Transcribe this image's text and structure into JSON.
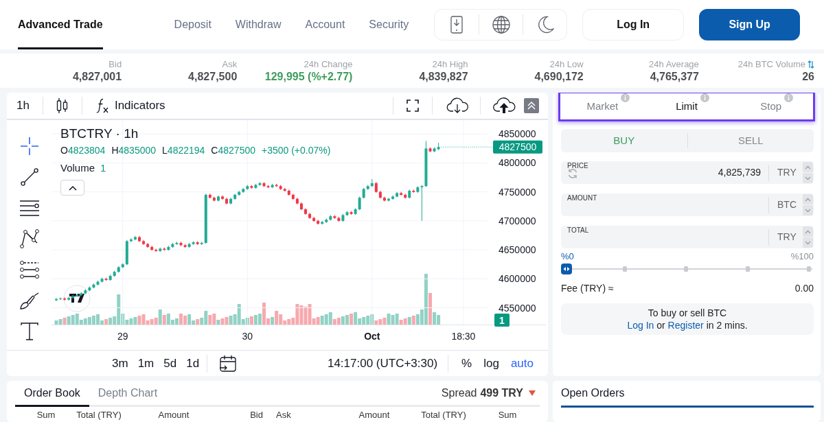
{
  "nav_tabs": [
    {
      "label": "Advanced Trade",
      "selected": true
    },
    {
      "label": "Deposit",
      "selected": false
    },
    {
      "label": "Withdraw",
      "selected": false
    },
    {
      "label": "Account",
      "selected": false
    },
    {
      "label": "Security",
      "selected": false
    }
  ],
  "auth": {
    "login": "Log In",
    "signup": "Sign Up"
  },
  "stats": [
    {
      "label": "Bid",
      "value": "4,827,001",
      "kind": "plain"
    },
    {
      "label": "Ask",
      "value": "4,827,500",
      "kind": "plain"
    },
    {
      "label": "24h Change",
      "value": "129,995 (%+2.77)",
      "kind": "change"
    },
    {
      "label": "24h High",
      "value": "4,839,827",
      "kind": "plain"
    },
    {
      "label": "24h Low",
      "value": "4,690,172",
      "kind": "plain"
    },
    {
      "label": "24h Average",
      "value": "4,765,377",
      "kind": "plain"
    },
    {
      "label": "24h BTC Volume",
      "value": "26",
      "kind": "switchable"
    }
  ],
  "chart": {
    "interval": "1h",
    "indicators": "Indicators",
    "title": "BTCTRY · 1h",
    "ohlc": [
      {
        "label": "O",
        "value": "4823804"
      },
      {
        "label": "H",
        "value": "4835000"
      },
      {
        "label": "L",
        "value": "4822194"
      },
      {
        "label": "C",
        "value": "4827500"
      }
    ],
    "change": "+3500 (+0.07%)",
    "volume_label": "Volume",
    "volume_value": "1",
    "drawing_tools": [
      {
        "kind": "crosshair",
        "selected": true
      },
      {
        "kind": "trend_line",
        "selected": false
      },
      {
        "kind": "horizontal_lines",
        "selected": false
      },
      {
        "kind": "pattern",
        "selected": false
      },
      {
        "kind": "channel",
        "selected": false
      },
      {
        "kind": "brush",
        "selected": false
      },
      {
        "kind": "text",
        "selected": false
      }
    ],
    "chart_data": {
      "type": "candlestick",
      "categories": [
        null,
        null,
        null,
        null,
        null,
        null,
        null,
        null,
        null,
        null,
        null,
        null,
        null,
        null,
        null,
        null,
        "29",
        null,
        null,
        null,
        null,
        null,
        null,
        null,
        null,
        null,
        null,
        null,
        null,
        null,
        null,
        null,
        null,
        null,
        null,
        null,
        null,
        null,
        null,
        null,
        null,
        null,
        null,
        null,
        null,
        null,
        "30",
        null,
        null,
        null,
        null,
        null,
        null,
        null,
        null,
        null,
        null,
        null,
        null,
        null,
        null,
        null,
        null,
        null,
        null,
        null,
        null,
        null,
        null,
        null,
        null,
        null,
        null,
        null,
        null,
        null,
        "Oct",
        null,
        null,
        null,
        null,
        null,
        null,
        null,
        null,
        null,
        null,
        null,
        null,
        null,
        null,
        null,
        null,
        null,
        null,
        null,
        null,
        null,
        "18:30"
      ],
      "ohlc": [
        [
          4563000,
          4567000,
          4561500,
          4565000
        ],
        [
          4565000,
          4568000,
          4563500,
          4566000
        ],
        [
          4566000,
          4568000,
          4562500,
          4564000
        ],
        [
          4564000,
          4569000,
          4562500,
          4567000
        ],
        [
          4567000,
          4572000,
          4565500,
          4570000
        ],
        [
          4570000,
          4574000,
          4568500,
          4572000
        ],
        [
          4572000,
          4577000,
          4570500,
          4575000
        ],
        [
          4575000,
          4582000,
          4573500,
          4580000
        ],
        [
          4580000,
          4587000,
          4578500,
          4585000
        ],
        [
          4585000,
          4592000,
          4583500,
          4590000
        ],
        [
          4590000,
          4597000,
          4588500,
          4595000
        ],
        [
          4595000,
          4602000,
          4593500,
          4600000
        ],
        [
          4600000,
          4602000,
          4596500,
          4598000
        ],
        [
          4598000,
          4607000,
          4596500,
          4605000
        ],
        [
          4605000,
          4614000,
          4603500,
          4612000
        ],
        [
          4612000,
          4622000,
          4610500,
          4620000
        ],
        [
          4620000,
          4627000,
          4618500,
          4625000
        ],
        [
          4625000,
          4667000,
          4623500,
          4665000
        ],
        [
          4665000,
          4670000,
          4663500,
          4668000
        ],
        [
          4668000,
          4674000,
          4666500,
          4672000
        ],
        [
          4672000,
          4674000,
          4663500,
          4665000
        ],
        [
          4665000,
          4667000,
          4658500,
          4660000
        ],
        [
          4660000,
          4662000,
          4653500,
          4655000
        ],
        [
          4655000,
          4657000,
          4648500,
          4650000
        ],
        [
          4650000,
          4652000,
          4646500,
          4648000
        ],
        [
          4648000,
          4654000,
          4646500,
          4652000
        ],
        [
          4652000,
          4654000,
          4648500,
          4650000
        ],
        [
          4650000,
          4657000,
          4648500,
          4655000
        ],
        [
          4655000,
          4662000,
          4653500,
          4660000
        ],
        [
          4660000,
          4664000,
          4658500,
          4662000
        ],
        [
          4662000,
          4664000,
          4656500,
          4658000
        ],
        [
          4658000,
          4660000,
          4653500,
          4655000
        ],
        [
          4655000,
          4662000,
          4653500,
          4660000
        ],
        [
          4660000,
          4665000,
          4658500,
          4663000
        ],
        [
          4663000,
          4665000,
          4658500,
          4660000
        ],
        [
          4660000,
          4664000,
          4658500,
          4662000
        ],
        [
          4662000,
          4747000,
          4660500,
          4745000
        ],
        [
          4745000,
          4747000,
          4738500,
          4740000
        ],
        [
          4740000,
          4742000,
          4733500,
          4735000
        ],
        [
          4735000,
          4744000,
          4733500,
          4742000
        ],
        [
          4742000,
          4744000,
          4736500,
          4738000
        ],
        [
          4738000,
          4740000,
          4728500,
          4730000
        ],
        [
          4730000,
          4740000,
          4728500,
          4738000
        ],
        [
          4738000,
          4747000,
          4736500,
          4745000
        ],
        [
          4745000,
          4752000,
          4743500,
          4750000
        ],
        [
          4750000,
          4757000,
          4748500,
          4755000
        ],
        [
          4755000,
          4762000,
          4753500,
          4760000
        ],
        [
          4760000,
          4762000,
          4755500,
          4757000
        ],
        [
          4757000,
          4764000,
          4755500,
          4762000
        ],
        [
          4762000,
          4767000,
          4760500,
          4765000
        ],
        [
          4765000,
          4767000,
          4758500,
          4760000
        ],
        [
          4760000,
          4762000,
          4756500,
          4758000
        ],
        [
          4758000,
          4764000,
          4756500,
          4762000
        ],
        [
          4762000,
          4764000,
          4758500,
          4760000
        ],
        [
          4760000,
          4762000,
          4753500,
          4755000
        ],
        [
          4755000,
          4757000,
          4750500,
          4752000
        ],
        [
          4752000,
          4754000,
          4743500,
          4745000
        ],
        [
          4745000,
          4747000,
          4736500,
          4738000
        ],
        [
          4738000,
          4740000,
          4728500,
          4730000
        ],
        [
          4730000,
          4732000,
          4718500,
          4720000
        ],
        [
          4720000,
          4722000,
          4710500,
          4712000
        ],
        [
          4712000,
          4714000,
          4703500,
          4705000
        ],
        [
          4705000,
          4707000,
          4698500,
          4700000
        ],
        [
          4700000,
          4702000,
          4693500,
          4695000
        ],
        [
          4695000,
          4700000,
          4693500,
          4698000
        ],
        [
          4698000,
          4704000,
          4696500,
          4702000
        ],
        [
          4702000,
          4710000,
          4700500,
          4708000
        ],
        [
          4708000,
          4710000,
          4703500,
          4705000
        ],
        [
          4705000,
          4707000,
          4698500,
          4700000
        ],
        [
          4700000,
          4712000,
          4698500,
          4710000
        ],
        [
          4710000,
          4717000,
          4708500,
          4715000
        ],
        [
          4715000,
          4717000,
          4710500,
          4712000
        ],
        [
          4712000,
          4722000,
          4710500,
          4720000
        ],
        [
          4720000,
          4742000,
          4718500,
          4740000
        ],
        [
          4740000,
          4757000,
          4738500,
          4755000
        ],
        [
          4755000,
          4762000,
          4753500,
          4760000
        ],
        [
          4760000,
          4772000,
          4758500,
          4765000
        ],
        [
          4765000,
          4767000,
          4748500,
          4750000
        ],
        [
          4750000,
          4752000,
          4738500,
          4740000
        ],
        [
          4740000,
          4742000,
          4733500,
          4735000
        ],
        [
          4735000,
          4740000,
          4733500,
          4738000
        ],
        [
          4738000,
          4744000,
          4736500,
          4742000
        ],
        [
          4742000,
          4750000,
          4740500,
          4748000
        ],
        [
          4748000,
          4750000,
          4743500,
          4745000
        ],
        [
          4745000,
          4747000,
          4738500,
          4740000
        ],
        [
          4740000,
          4754000,
          4738500,
          4752000
        ],
        [
          4752000,
          4754000,
          4748500,
          4750000
        ],
        [
          4750000,
          4760000,
          4748500,
          4758000
        ],
        [
          4758000,
          4762000,
          4700000,
          4760000
        ],
        [
          4760000,
          4838000,
          4758500,
          4825000
        ],
        [
          4825000,
          4827000,
          4818500,
          4820000
        ],
        [
          4820000,
          4827000,
          4818500,
          4825000
        ],
        [
          4823804,
          4835000,
          4822194,
          4827500
        ],
        null,
        null,
        null,
        null,
        null,
        null
      ],
      "ylim": [
        4521000,
        4874000
      ],
      "yticks": [
        4850000,
        4800000,
        4750000,
        4700000,
        4650000,
        4600000,
        4550000
      ],
      "grid": true
    },
    "last_price": "4827500",
    "volume_tag": "1",
    "ranges": [
      "3m",
      "1m",
      "5d",
      "1d"
    ],
    "time": "14:17:00 (UTC+3:30)",
    "scale_options": [
      {
        "label": "%",
        "selected": false
      },
      {
        "label": "log",
        "selected": false
      },
      {
        "label": "auto",
        "selected": true
      }
    ]
  },
  "order_book": {
    "tabs": [
      {
        "label": "Order Book",
        "selected": true
      },
      {
        "label": "Depth Chart",
        "selected": false
      }
    ],
    "spread_label": "Spread",
    "spread_value": "499 TRY",
    "columns": [
      "Sum",
      "Total (TRY)",
      "Amount",
      "Bid",
      "Ask",
      "Amount",
      "Total (TRY)",
      "Sum"
    ]
  },
  "order_panel": {
    "highlighted": true,
    "order_types": [
      {
        "label": "Market",
        "selected": false
      },
      {
        "label": "Limit",
        "selected": true
      },
      {
        "label": "Stop",
        "selected": false
      }
    ],
    "sides": [
      {
        "label": "BUY",
        "selected": true
      },
      {
        "label": "SELL",
        "selected": false
      }
    ],
    "fields": [
      {
        "label": "PRICE",
        "value": "4,825,739",
        "unit": "TRY",
        "kind": "refreshable"
      },
      {
        "label": "AMOUNT",
        "unit": "BTC",
        "kind": "plain"
      },
      {
        "label": "TOTAL",
        "unit": "TRY",
        "kind": "plain"
      }
    ],
    "slider": {
      "min_label": "%0",
      "max_label": "%100",
      "level": 0
    },
    "fee": {
      "label": "Fee (TRY) ≈",
      "value": "0.00"
    },
    "notice": {
      "title": "To buy or sell BTC",
      "parts": [
        {
          "kind": "link",
          "text": "Log In"
        },
        {
          "kind": "text",
          "text": "or"
        },
        {
          "kind": "link",
          "text": "Register"
        },
        {
          "kind": "text",
          "text": "in 2 mins."
        }
      ]
    }
  },
  "open_orders": {
    "tabs": [
      {
        "label": "Open Orders",
        "selected": true
      }
    ]
  }
}
